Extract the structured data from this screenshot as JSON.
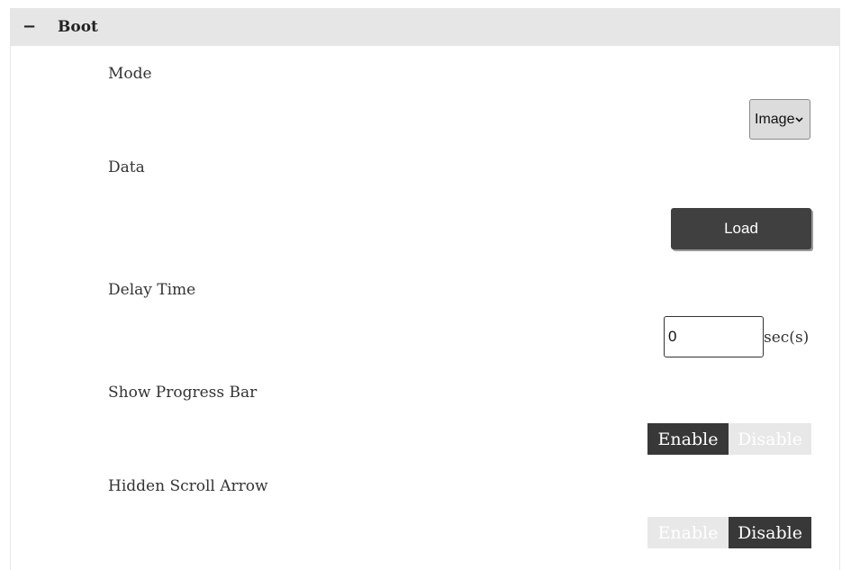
{
  "section": {
    "collapse_symbol": "−",
    "title": "Boot"
  },
  "mode": {
    "label": "Mode",
    "selected": "Image"
  },
  "data": {
    "label": "Data",
    "button_label": "Load"
  },
  "delay_time": {
    "label": "Delay Time",
    "value": "0",
    "unit": "sec(s)"
  },
  "show_progress_bar": {
    "label": "Show Progress Bar",
    "enable_label": "Enable",
    "disable_label": "Disable",
    "state": "Enable"
  },
  "hidden_scroll_arrow": {
    "label": "Hidden Scroll Arrow",
    "enable_label": "Enable",
    "disable_label": "Disable",
    "state": "Disable"
  },
  "icons": {
    "collapse": "minus-icon",
    "select_arrow": "chevron-down-icon"
  },
  "colors": {
    "header_bg": "#e6e6e6",
    "active_toggle": "#383838",
    "inactive_toggle": "#e8e8e8",
    "button_bg": "#404040"
  }
}
